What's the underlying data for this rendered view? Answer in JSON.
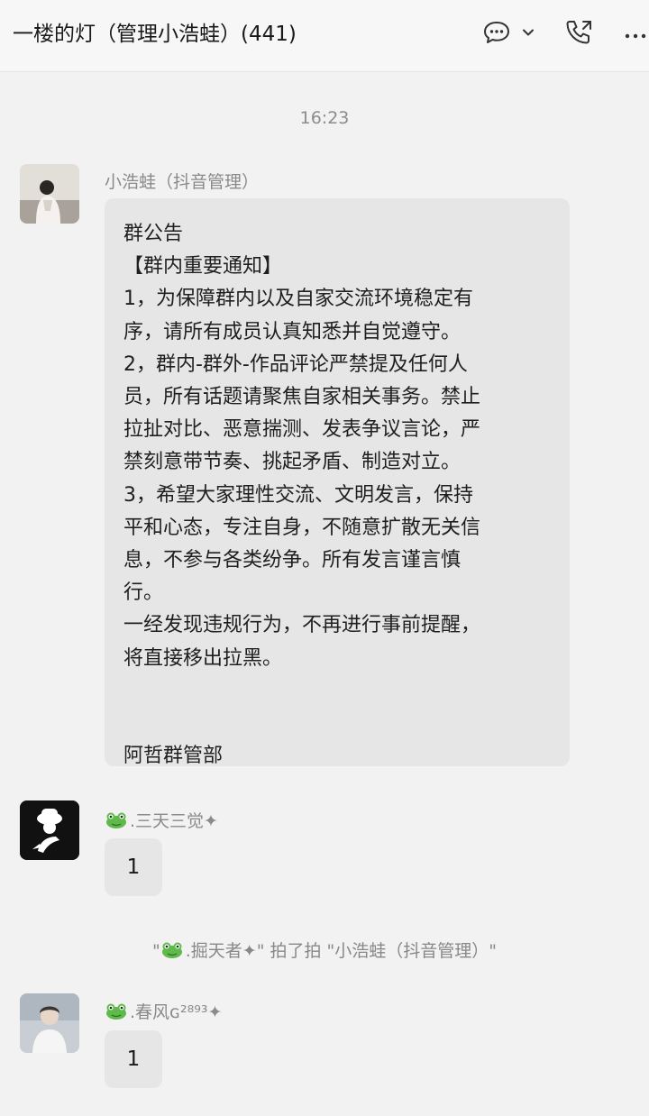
{
  "header": {
    "title": "一楼的灯（管理小浩蛙）(441)",
    "icons": [
      "chat-bubble-icon",
      "chevron-down-icon",
      "phone-icon",
      "more-icon"
    ]
  },
  "chat": {
    "timestamp": "16:23",
    "messages": [
      {
        "sender": "小浩蛙（抖音管理）",
        "lines": [
          "群公告",
          "【群内重要通知】",
          "1，为保障群内以及自家交流环境稳定有",
          "序，请所有成员认真知悉并自觉遵守。",
          "2，群内-群外-作品评论严禁提及任何人",
          "员，所有话题请聚焦自家相关事务。禁止",
          "拉扯对比、恶意揣测、发表争议言论，严",
          "禁刻意带节奏、挑起矛盾、制造对立。",
          "3，希望大家理性交流、文明发言，保持",
          "平和心态，专注自身，不随意扩散无关信",
          "息，不参与各类纷争。所有发言谨言慎",
          "行。",
          "一经发现违规行为，不再进行事前提醒，",
          "将直接移出拉黑。",
          "",
          "",
          "阿哲群管部"
        ]
      },
      {
        "sender": ".三天三觉✦",
        "text": "1"
      },
      {
        "sender": ".春风ɢ²⁸⁹³✦",
        "text": "1"
      }
    ],
    "system_notice": {
      "open_quote": "\"",
      "actor": ".掘天者✦",
      "middle": "\" 拍了拍 \"小浩蛙（抖音管理）\""
    }
  },
  "colors": {
    "background": "#f2f2f2",
    "bubble": "#e6e6e6",
    "muted_text": "#8c8c8c"
  }
}
